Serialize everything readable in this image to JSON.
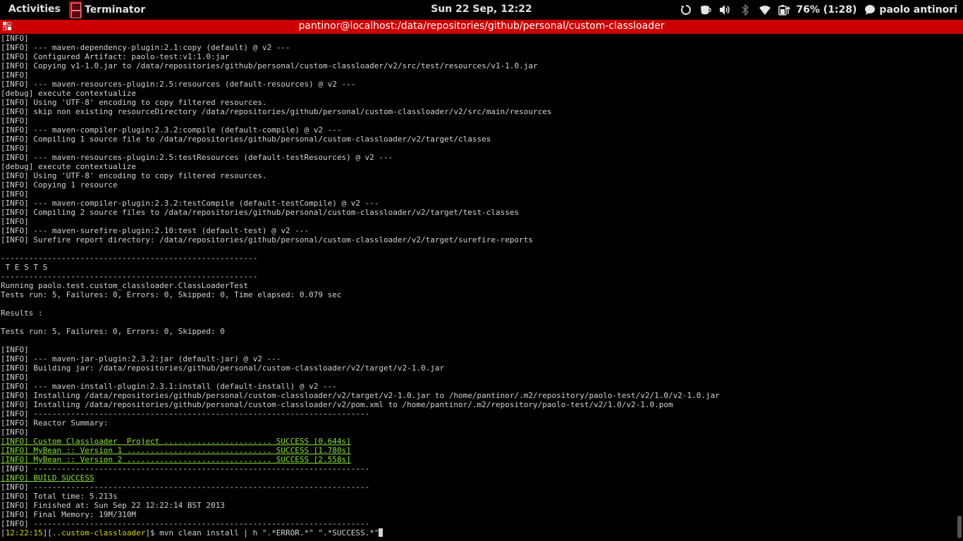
{
  "topbar": {
    "activities": "Activities",
    "app_name": "Terminator",
    "clock": "Sun 22 Sep, 12:22",
    "battery_text": "76% (1:28)",
    "user_name": "paolo antinori",
    "icons": [
      "sync-icon",
      "coffee-icon",
      "volume-icon",
      "bluetooth-icon",
      "wifi-icon",
      "battery-icon",
      "chat-icon"
    ]
  },
  "window": {
    "title": "pantinor@localhost:/data/repositories/github/personal/custom-classloader"
  },
  "terminal": {
    "lines": [
      {
        "text": "[INFO]",
        "style": "normal"
      },
      {
        "text": "[INFO] --- maven-dependency-plugin:2.1:copy (default) @ v2 ---",
        "style": "normal"
      },
      {
        "text": "[INFO] Configured Artifact: paolo-test:v1:1.0:jar",
        "style": "normal"
      },
      {
        "text": "[INFO] Copying v1-1.0.jar to /data/repositories/github/personal/custom-classloader/v2/src/test/resources/v1-1.0.jar",
        "style": "normal"
      },
      {
        "text": "[INFO]",
        "style": "normal"
      },
      {
        "text": "[INFO] --- maven-resources-plugin:2.5:resources (default-resources) @ v2 ---",
        "style": "normal"
      },
      {
        "text": "[debug] execute contextualize",
        "style": "normal"
      },
      {
        "text": "[INFO] Using 'UTF-8' encoding to copy filtered resources.",
        "style": "normal"
      },
      {
        "text": "[INFO] skip non existing resourceDirectory /data/repositories/github/personal/custom-classloader/v2/src/main/resources",
        "style": "normal"
      },
      {
        "text": "[INFO]",
        "style": "normal"
      },
      {
        "text": "[INFO] --- maven-compiler-plugin:2.3.2:compile (default-compile) @ v2 ---",
        "style": "normal"
      },
      {
        "text": "[INFO] Compiling 1 source file to /data/repositories/github/personal/custom-classloader/v2/target/classes",
        "style": "normal"
      },
      {
        "text": "[INFO]",
        "style": "normal"
      },
      {
        "text": "[INFO] --- maven-resources-plugin:2.5:testResources (default-testResources) @ v2 ---",
        "style": "normal"
      },
      {
        "text": "[debug] execute contextualize",
        "style": "normal"
      },
      {
        "text": "[INFO] Using 'UTF-8' encoding to copy filtered resources.",
        "style": "normal"
      },
      {
        "text": "[INFO] Copying 1 resource",
        "style": "normal"
      },
      {
        "text": "[INFO]",
        "style": "normal"
      },
      {
        "text": "[INFO] --- maven-compiler-plugin:2.3.2:testCompile (default-testCompile) @ v2 ---",
        "style": "normal"
      },
      {
        "text": "[INFO] Compiling 2 source files to /data/repositories/github/personal/custom-classloader/v2/target/test-classes",
        "style": "normal"
      },
      {
        "text": "[INFO]",
        "style": "normal"
      },
      {
        "text": "[INFO] --- maven-surefire-plugin:2.10:test (default-test) @ v2 ---",
        "style": "normal"
      },
      {
        "text": "[INFO] Surefire report directory: /data/repositories/github/personal/custom-classloader/v2/target/surefire-reports",
        "style": "normal"
      },
      {
        "text": "",
        "style": "normal"
      },
      {
        "text": "-------------------------------------------------------",
        "style": "normal"
      },
      {
        "text": " T E S T S",
        "style": "normal"
      },
      {
        "text": "-------------------------------------------------------",
        "style": "normal"
      },
      {
        "text": "Running paolo.test.custom_classloader.ClassLoaderTest",
        "style": "normal"
      },
      {
        "text": "Tests run: 5, Failures: 0, Errors: 0, Skipped: 0, Time elapsed: 0.079 sec",
        "style": "normal"
      },
      {
        "text": "",
        "style": "normal"
      },
      {
        "text": "Results :",
        "style": "normal"
      },
      {
        "text": "",
        "style": "normal"
      },
      {
        "text": "Tests run: 5, Failures: 0, Errors: 0, Skipped: 0",
        "style": "normal"
      },
      {
        "text": "",
        "style": "normal"
      },
      {
        "text": "[INFO]",
        "style": "normal"
      },
      {
        "text": "[INFO] --- maven-jar-plugin:2.3.2:jar (default-jar) @ v2 ---",
        "style": "normal"
      },
      {
        "text": "[INFO] Building jar: /data/repositories/github/personal/custom-classloader/v2/target/v2-1.0.jar",
        "style": "normal"
      },
      {
        "text": "[INFO]",
        "style": "normal"
      },
      {
        "text": "[INFO] --- maven-install-plugin:2.3.1:install (default-install) @ v2 ---",
        "style": "normal"
      },
      {
        "text": "[INFO] Installing /data/repositories/github/personal/custom-classloader/v2/target/v2-1.0.jar to /home/pantinor/.m2/repository/paolo-test/v2/1.0/v2-1.0.jar",
        "style": "normal"
      },
      {
        "text": "[INFO] Installing /data/repositories/github/personal/custom-classloader/v2/pom.xml to /home/pantinor/.m2/repository/paolo-test/v2/1.0/v2-1.0.pom",
        "style": "normal"
      },
      {
        "text": "[INFO] ------------------------------------------------------------------------",
        "style": "normal"
      },
      {
        "text": "[INFO] Reactor Summary:",
        "style": "normal"
      },
      {
        "text": "[INFO]",
        "style": "normal"
      },
      {
        "text": "[INFO] Custom Classloader  Project ....................... SUCCESS [0.644s]",
        "style": "success"
      },
      {
        "text": "[INFO] MyBean :: Version 1 ............................... SUCCESS [1.780s]",
        "style": "success"
      },
      {
        "text": "[INFO] MyBean :: Version 2 ............................... SUCCESS [2.558s]",
        "style": "success"
      },
      {
        "text": "[INFO] ------------------------------------------------------------------------",
        "style": "normal"
      },
      {
        "text": "[INFO] BUILD SUCCESS",
        "style": "success"
      },
      {
        "text": "[INFO] ------------------------------------------------------------------------",
        "style": "normal"
      },
      {
        "text": "[INFO] Total time: 5.213s",
        "style": "normal"
      },
      {
        "text": "[INFO] Finished at: Sun Sep 22 12:22:14 BST 2013",
        "style": "normal"
      },
      {
        "text": "[INFO] Final Memory: 19M/310M",
        "style": "normal"
      },
      {
        "text": "[INFO] ------------------------------------------------------------------------",
        "style": "normal"
      }
    ],
    "prompt": {
      "timestamp": "12:22:15",
      "dir": "..custom-classloader",
      "command": "$ mvn clean install | h \".*ERROR.*\" \".*SUCCESS.*\""
    }
  },
  "colors": {
    "titlebar": "#cc0000",
    "success_text": "#8ae234",
    "prompt_accent": "#d7d700"
  }
}
